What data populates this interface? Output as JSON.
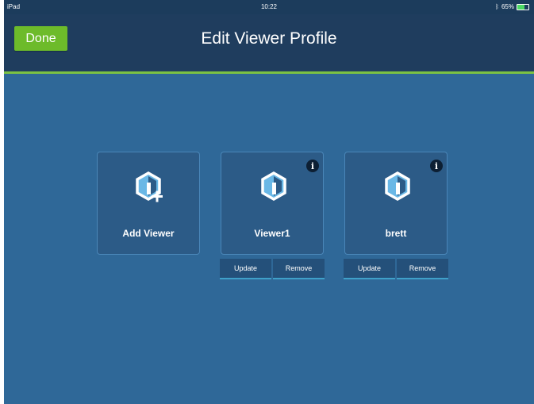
{
  "status_bar": {
    "device": "iPad",
    "time": "10:22",
    "battery": "65%",
    "battery_level": 0.65
  },
  "header": {
    "done_label": "Done",
    "title": "Edit Viewer Profile"
  },
  "colors": {
    "accent": "#7cc242",
    "done_button": "#6dbb2a",
    "background": "#2f6898"
  },
  "cards": [
    {
      "label": "Add Viewer",
      "icon": "add-viewer-icon"
    },
    {
      "label": "Viewer1",
      "icon": "viewer-profile-icon",
      "info_icon": "info-icon",
      "update_label": "Update",
      "remove_label": "Remove"
    },
    {
      "label": "brett",
      "icon": "viewer-profile-icon",
      "info_icon": "info-icon",
      "update_label": "Update",
      "remove_label": "Remove"
    }
  ]
}
